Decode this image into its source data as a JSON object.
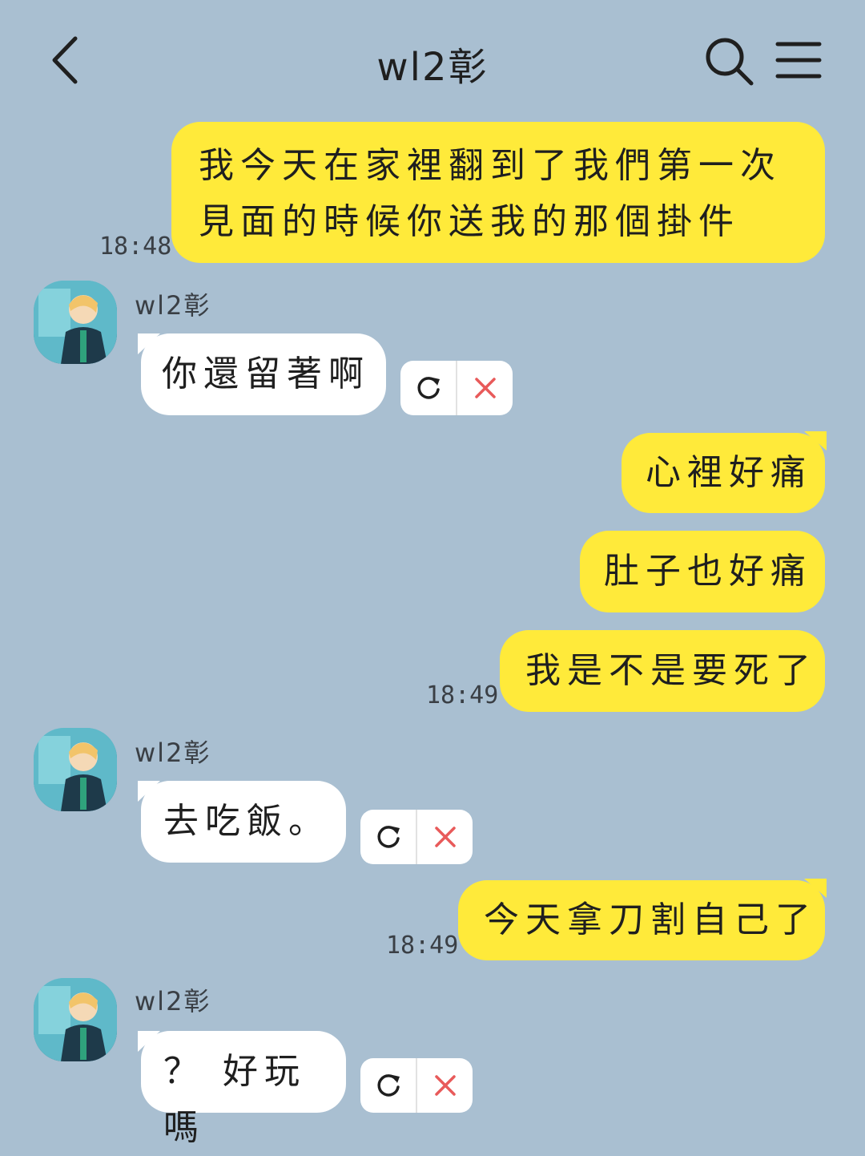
{
  "header": {
    "title": "wl2彰"
  },
  "messages": [
    {
      "side": "me",
      "text_line1": "我今天在家裡翻到了我們第一次",
      "text_line2": "見面的時候你送我的那個掛件",
      "time": "18:48"
    },
    {
      "side": "them",
      "sender": "wl2彰",
      "text": "你還留著啊"
    },
    {
      "side": "me",
      "text": "心裡好痛"
    },
    {
      "side": "me",
      "text": "肚子也好痛"
    },
    {
      "side": "me",
      "text": "我是不是要死了",
      "time": "18:49"
    },
    {
      "side": "them",
      "sender": "wl2彰",
      "text": "去吃飯。"
    },
    {
      "side": "me",
      "text": "今天拿刀割自己了",
      "time": "18:49"
    },
    {
      "side": "them",
      "sender": "wl2彰",
      "text": "？ 好玩嗎"
    }
  ],
  "icons": {
    "back": "chevron-left-icon",
    "search": "search-icon",
    "menu": "menu-icon",
    "retry": "retry-icon",
    "delete": "close-icon"
  },
  "colors": {
    "background": "#a9bfd1",
    "my_bubble": "#ffea3a",
    "their_bubble": "#ffffff",
    "delete_icon": "#e85a5a"
  }
}
